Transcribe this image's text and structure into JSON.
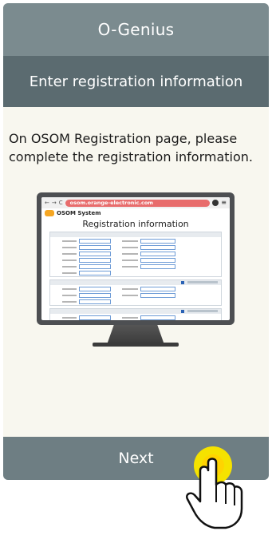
{
  "header": {
    "app_title": "O-Genius",
    "step_title": "Enter registration information"
  },
  "instructions": "On OSOM Registration page, please complete the registration information.",
  "illustration": {
    "url": "osom.orange-electronic.com",
    "brand": "OSOM System",
    "page_heading": "Registration information"
  },
  "footer": {
    "next_label": "Next"
  },
  "colors": {
    "title_bar": "#7b8b8f",
    "subtitle_bar": "#5b6b70",
    "next_button": "#6e7e83",
    "hand_fill": "#f5e200"
  }
}
